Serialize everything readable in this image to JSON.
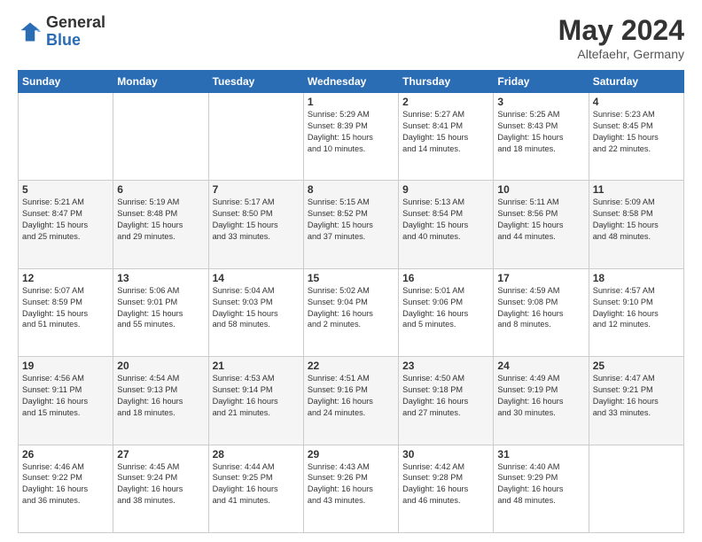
{
  "header": {
    "logo_general": "General",
    "logo_blue": "Blue",
    "month_title": "May 2024",
    "location": "Altefaehr, Germany"
  },
  "days_of_week": [
    "Sunday",
    "Monday",
    "Tuesday",
    "Wednesday",
    "Thursday",
    "Friday",
    "Saturday"
  ],
  "weeks": [
    [
      {
        "day": "",
        "info": ""
      },
      {
        "day": "",
        "info": ""
      },
      {
        "day": "",
        "info": ""
      },
      {
        "day": "1",
        "info": "Sunrise: 5:29 AM\nSunset: 8:39 PM\nDaylight: 15 hours\nand 10 minutes."
      },
      {
        "day": "2",
        "info": "Sunrise: 5:27 AM\nSunset: 8:41 PM\nDaylight: 15 hours\nand 14 minutes."
      },
      {
        "day": "3",
        "info": "Sunrise: 5:25 AM\nSunset: 8:43 PM\nDaylight: 15 hours\nand 18 minutes."
      },
      {
        "day": "4",
        "info": "Sunrise: 5:23 AM\nSunset: 8:45 PM\nDaylight: 15 hours\nand 22 minutes."
      }
    ],
    [
      {
        "day": "5",
        "info": "Sunrise: 5:21 AM\nSunset: 8:47 PM\nDaylight: 15 hours\nand 25 minutes."
      },
      {
        "day": "6",
        "info": "Sunrise: 5:19 AM\nSunset: 8:48 PM\nDaylight: 15 hours\nand 29 minutes."
      },
      {
        "day": "7",
        "info": "Sunrise: 5:17 AM\nSunset: 8:50 PM\nDaylight: 15 hours\nand 33 minutes."
      },
      {
        "day": "8",
        "info": "Sunrise: 5:15 AM\nSunset: 8:52 PM\nDaylight: 15 hours\nand 37 minutes."
      },
      {
        "day": "9",
        "info": "Sunrise: 5:13 AM\nSunset: 8:54 PM\nDaylight: 15 hours\nand 40 minutes."
      },
      {
        "day": "10",
        "info": "Sunrise: 5:11 AM\nSunset: 8:56 PM\nDaylight: 15 hours\nand 44 minutes."
      },
      {
        "day": "11",
        "info": "Sunrise: 5:09 AM\nSunset: 8:58 PM\nDaylight: 15 hours\nand 48 minutes."
      }
    ],
    [
      {
        "day": "12",
        "info": "Sunrise: 5:07 AM\nSunset: 8:59 PM\nDaylight: 15 hours\nand 51 minutes."
      },
      {
        "day": "13",
        "info": "Sunrise: 5:06 AM\nSunset: 9:01 PM\nDaylight: 15 hours\nand 55 minutes."
      },
      {
        "day": "14",
        "info": "Sunrise: 5:04 AM\nSunset: 9:03 PM\nDaylight: 15 hours\nand 58 minutes."
      },
      {
        "day": "15",
        "info": "Sunrise: 5:02 AM\nSunset: 9:04 PM\nDaylight: 16 hours\nand 2 minutes."
      },
      {
        "day": "16",
        "info": "Sunrise: 5:01 AM\nSunset: 9:06 PM\nDaylight: 16 hours\nand 5 minutes."
      },
      {
        "day": "17",
        "info": "Sunrise: 4:59 AM\nSunset: 9:08 PM\nDaylight: 16 hours\nand 8 minutes."
      },
      {
        "day": "18",
        "info": "Sunrise: 4:57 AM\nSunset: 9:10 PM\nDaylight: 16 hours\nand 12 minutes."
      }
    ],
    [
      {
        "day": "19",
        "info": "Sunrise: 4:56 AM\nSunset: 9:11 PM\nDaylight: 16 hours\nand 15 minutes."
      },
      {
        "day": "20",
        "info": "Sunrise: 4:54 AM\nSunset: 9:13 PM\nDaylight: 16 hours\nand 18 minutes."
      },
      {
        "day": "21",
        "info": "Sunrise: 4:53 AM\nSunset: 9:14 PM\nDaylight: 16 hours\nand 21 minutes."
      },
      {
        "day": "22",
        "info": "Sunrise: 4:51 AM\nSunset: 9:16 PM\nDaylight: 16 hours\nand 24 minutes."
      },
      {
        "day": "23",
        "info": "Sunrise: 4:50 AM\nSunset: 9:18 PM\nDaylight: 16 hours\nand 27 minutes."
      },
      {
        "day": "24",
        "info": "Sunrise: 4:49 AM\nSunset: 9:19 PM\nDaylight: 16 hours\nand 30 minutes."
      },
      {
        "day": "25",
        "info": "Sunrise: 4:47 AM\nSunset: 9:21 PM\nDaylight: 16 hours\nand 33 minutes."
      }
    ],
    [
      {
        "day": "26",
        "info": "Sunrise: 4:46 AM\nSunset: 9:22 PM\nDaylight: 16 hours\nand 36 minutes."
      },
      {
        "day": "27",
        "info": "Sunrise: 4:45 AM\nSunset: 9:24 PM\nDaylight: 16 hours\nand 38 minutes."
      },
      {
        "day": "28",
        "info": "Sunrise: 4:44 AM\nSunset: 9:25 PM\nDaylight: 16 hours\nand 41 minutes."
      },
      {
        "day": "29",
        "info": "Sunrise: 4:43 AM\nSunset: 9:26 PM\nDaylight: 16 hours\nand 43 minutes."
      },
      {
        "day": "30",
        "info": "Sunrise: 4:42 AM\nSunset: 9:28 PM\nDaylight: 16 hours\nand 46 minutes."
      },
      {
        "day": "31",
        "info": "Sunrise: 4:40 AM\nSunset: 9:29 PM\nDaylight: 16 hours\nand 48 minutes."
      },
      {
        "day": "",
        "info": ""
      }
    ]
  ]
}
